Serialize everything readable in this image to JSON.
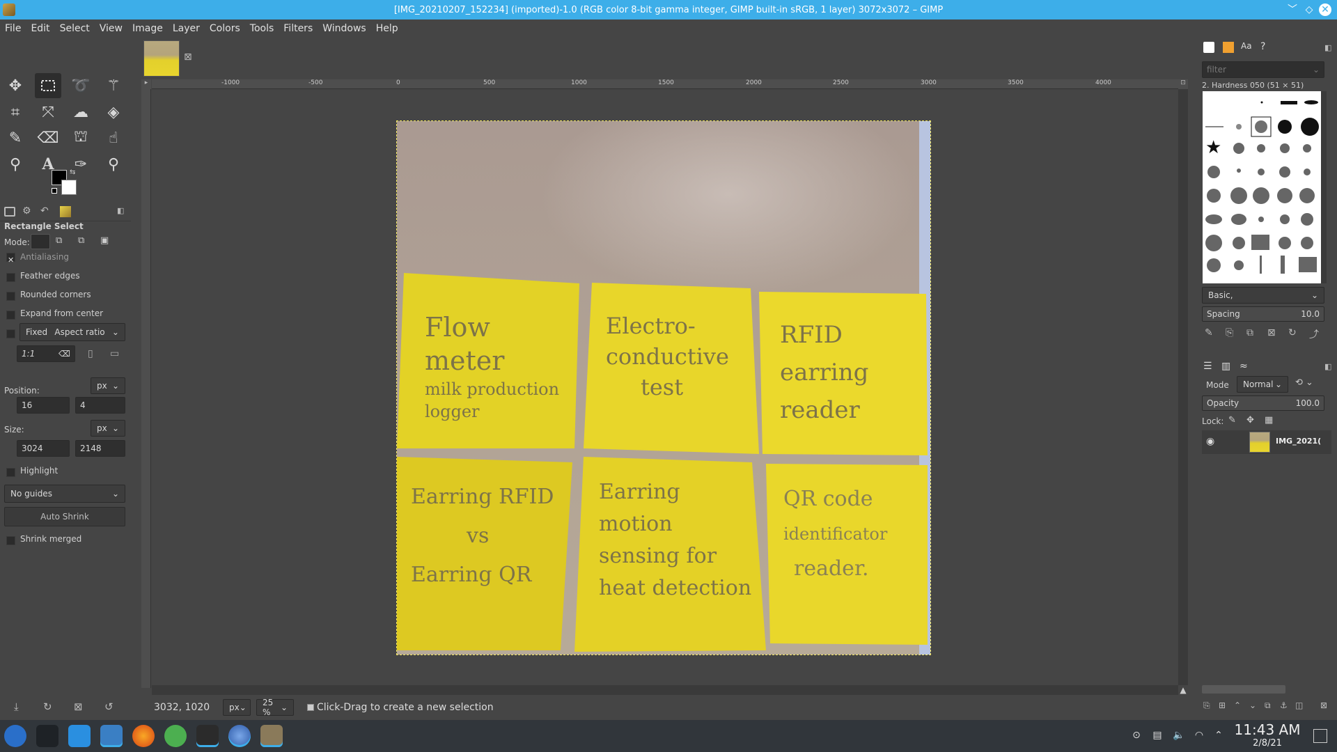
{
  "window": {
    "title": "[IMG_20210207_152234] (imported)-1.0 (RGB color 8-bit gamma integer, GIMP built-in sRGB, 1 layer) 3072x3072 – GIMP"
  },
  "menu": [
    "File",
    "Edit",
    "Select",
    "View",
    "Image",
    "Layer",
    "Colors",
    "Tools",
    "Filters",
    "Windows",
    "Help"
  ],
  "tool_options": {
    "title": "Rectangle Select",
    "mode_label": "Mode:",
    "antialiasing": "Antialiasing",
    "feather_edges": "Feather edges",
    "rounded_corners": "Rounded corners",
    "expand_from_center": "Expand from center",
    "fixed": "Fixed",
    "aspect_ratio": "Aspect ratio",
    "ratio_value": "1:1",
    "position_label": "Position:",
    "position_unit": "px",
    "position_x": "16",
    "position_y": "4",
    "size_label": "Size:",
    "size_unit": "px",
    "size_w": "3024",
    "size_h": "2148",
    "highlight": "Highlight",
    "guides": "No guides",
    "auto_shrink": "Auto Shrink",
    "shrink_merged": "Shrink merged"
  },
  "ruler_labels": [
    "-1000",
    "-500",
    "0",
    "500",
    "1000",
    "1500",
    "2000",
    "2500",
    "3000",
    "3500",
    "4000"
  ],
  "sticky_notes": [
    {
      "line1": "Flow",
      "line2": "meter",
      "line3": "milk production",
      "line4": "logger"
    },
    {
      "line1": "Electro-",
      "line2": "conductive",
      "line3": "test",
      "line4": ""
    },
    {
      "line1": "RFID",
      "line2": "earring",
      "line3": "reader",
      "line4": ""
    },
    {
      "line1": "Earring RFID",
      "line2": "vs",
      "line3": "Earring QR",
      "line4": ""
    },
    {
      "line1": "Earring",
      "line2": "motion",
      "line3": "sensing for",
      "line4": "heat detection"
    },
    {
      "line1": "QR code",
      "line2": "identificator",
      "line3": "reader.",
      "line4": ""
    }
  ],
  "status": {
    "coords": "3032, 1020",
    "unit": "px",
    "zoom": "25 %",
    "message": "Click-Drag to create a new selection"
  },
  "brushes": {
    "filter_placeholder": "filter",
    "current": "2. Hardness 050 (51 × 51)",
    "tag": "Basic,",
    "spacing_label": "Spacing",
    "spacing_value": "10.0"
  },
  "layers": {
    "mode_label": "Mode",
    "mode_value": "Normal",
    "opacity_label": "Opacity",
    "opacity_value": "100.0",
    "lock_label": "Lock:",
    "layer_name": "IMG_2021("
  },
  "taskbar": {
    "time": "11:43 AM",
    "date": "2/8/21"
  },
  "colors": {
    "accent": "#3daee9",
    "fg_color": "#000000",
    "bg_color": "#ffffff",
    "note_yellow": "#ecdc28"
  }
}
